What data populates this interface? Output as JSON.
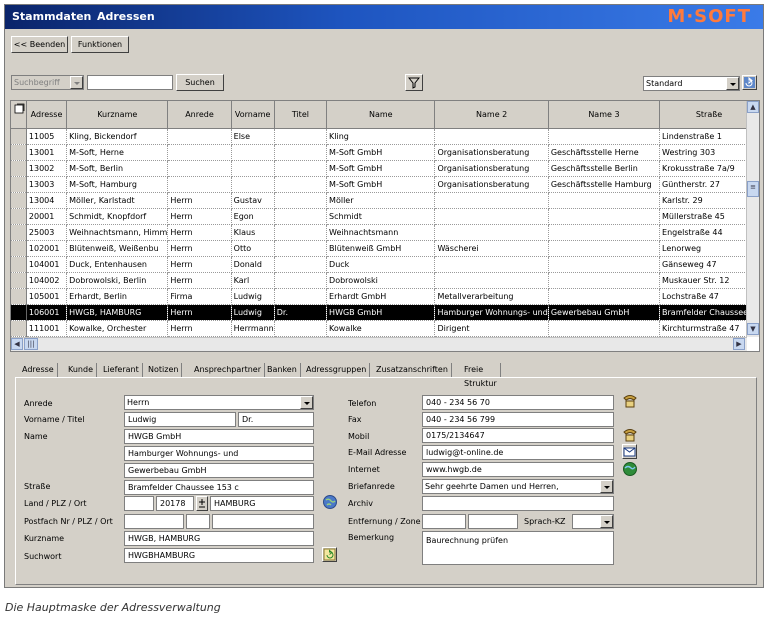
{
  "window": {
    "title_left": "Stammdaten",
    "title_right": "Adressen",
    "logo": "M·SOFT"
  },
  "toolbar": {
    "beenden_label": "<< Beenden",
    "funktionen_label": "Funktionen"
  },
  "search": {
    "criteria": "Suchbegriff",
    "value": "",
    "button": "Suchen",
    "view": "Standard",
    "filter_icon": "funnel-icon"
  },
  "grid": {
    "columns": [
      "Adresse",
      "Kurzname",
      "Anrede",
      "Vorname",
      "Titel",
      "Name",
      "Name 2",
      "Name 3",
      "Straße"
    ],
    "rows": [
      [
        "11005",
        "Kling, Bickendorf",
        "",
        "Else",
        "",
        "Kling",
        "",
        "",
        "Lindenstraße 1"
      ],
      [
        "13001",
        "M-Soft, Herne",
        "",
        "",
        "",
        "M-Soft GmbH",
        "Organisationsberatung",
        "Geschäftsstelle Herne",
        "Westring 303"
      ],
      [
        "13002",
        "M-Soft, Berlin",
        "",
        "",
        "",
        "M-Soft GmbH",
        "Organisationsberatung",
        "Geschäftsstelle Berlin",
        "Krokusstraße 7a/9"
      ],
      [
        "13003",
        "M-Soft, Hamburg",
        "",
        "",
        "",
        "M-Soft GmbH",
        "Organisationsberatung",
        "Geschäftsstelle Hamburg",
        "Güntherstr. 27"
      ],
      [
        "13004",
        "Möller, Karlstadt",
        "Herrn",
        "Gustav",
        "",
        "Möller",
        "",
        "",
        "Karlstr. 29"
      ],
      [
        "20001",
        "Schmidt, Knopfdorf",
        "Herrn",
        "Egon",
        "",
        "Schmidt",
        "",
        "",
        "Müllerstraße 45"
      ],
      [
        "25003",
        "Weihnachtsmann, Himm",
        "Herrn",
        "Klaus",
        "",
        "Weihnachtsmann",
        "",
        "",
        "Engelstraße 44"
      ],
      [
        "102001",
        "Blütenweiß, Weißenbu",
        "Herrn",
        "Otto",
        "",
        "Blütenweiß GmbH",
        "Wäscherei",
        "",
        "Lenorweg"
      ],
      [
        "104001",
        "Duck, Entenhausen",
        "Herrn",
        "Donald",
        "",
        "Duck",
        "",
        "",
        "Gänseweg 47"
      ],
      [
        "104002",
        "Dobrowolski, Berlin",
        "Herrn",
        "Karl",
        "",
        "Dobrowolski",
        "",
        "",
        "Muskauer Str. 12"
      ],
      [
        "105001",
        "Erhardt, Berlin",
        "Firma",
        "Ludwig",
        "",
        "Erhardt GmbH",
        "Metallverarbeitung",
        "",
        "Lochstraße 47"
      ],
      [
        "106001",
        "HWGB, HAMBURG",
        "Herrn",
        "Ludwig",
        "Dr.",
        "HWGB GmbH",
        "Hamburger Wohnungs- und",
        "Gewerbebau GmbH",
        "Bramfelder Chaussee"
      ],
      [
        "111001",
        "Kowalke, Orchester",
        "Herrn",
        "Herrmann",
        "",
        "Kowalke",
        "Dirigent",
        "",
        "Kirchturmstraße 47"
      ]
    ],
    "selected_index": 11
  },
  "tabs": [
    "Adresse",
    "Kunde",
    "Lieferant",
    "Notizen",
    "Ansprechpartner",
    "Banken",
    "Adressgruppen",
    "Zusatzanschriften",
    "Freie Struktur"
  ],
  "form": {
    "anrede_label": "Anrede",
    "anrede": "Herrn",
    "vorname_label": "Vorname / Titel",
    "vorname": "Ludwig",
    "titel": "Dr.",
    "name_label": "Name",
    "name1": "HWGB GmbH",
    "name2": "Hamburger Wohnungs- und",
    "name3": "Gewerbebau GmbH",
    "strasse_label": "Straße",
    "strasse": "Bramfelder Chaussee 153 c",
    "ort_label": "Land / PLZ / Ort",
    "land": "",
    "plz": "20178",
    "ort": "HAMBURG",
    "postfach_label": "Postfach Nr / PLZ / Ort",
    "postfach": "",
    "postfach_plz": "",
    "postfach_ort": "",
    "kurzname_label": "Kurzname",
    "kurzname": "HWGB, HAMBURG",
    "suchwort_label": "Suchwort",
    "suchwort": "HWGBHAMBURG",
    "telefon_label": "Telefon",
    "telefon": "040 - 234 56 70",
    "fax_label": "Fax",
    "fax": "040 - 234 56 799",
    "mobil_label": "Mobil",
    "mobil": "0175/2134647",
    "email_label": "E-Mail Adresse",
    "email": "ludwig@t-online.de",
    "internet_label": "Internet",
    "internet": "www.hwgb.de",
    "brief_label": "Briefanrede",
    "brief": "Sehr geehrte Damen und Herren,",
    "archiv_label": "Archiv",
    "archiv": "",
    "entfernung_label": "Entfernung / Zone",
    "entfernung": "",
    "zone": "",
    "sprach_label": "Sprach-KZ",
    "sprach": "",
    "bemerkung_label": "Bemerkung",
    "bemerkung": "Baurechnung prüfen"
  },
  "caption": "Die Hauptmaske der Adressverwaltung"
}
